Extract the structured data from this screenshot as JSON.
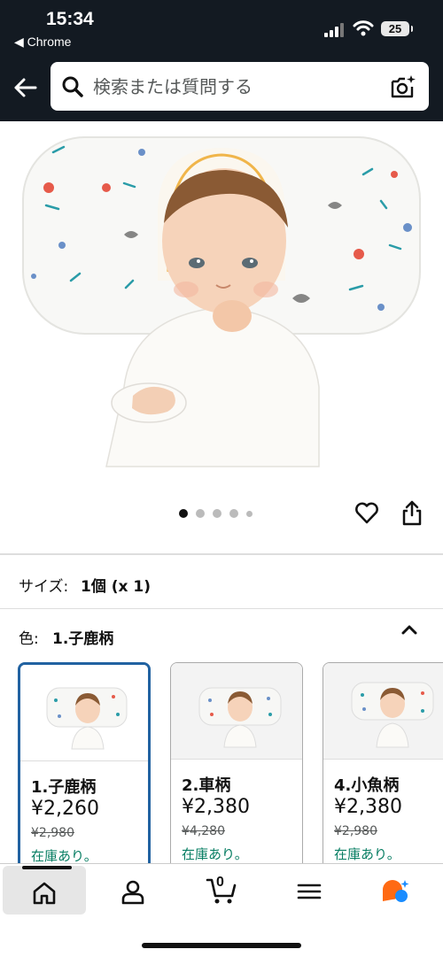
{
  "status_bar": {
    "time": "15:34",
    "back_app": "◀ Chrome",
    "battery": "25"
  },
  "search": {
    "placeholder": "検索または質問する"
  },
  "gallery": {
    "image_count": 5,
    "active_index": 0
  },
  "size": {
    "label": "サイズ:",
    "value": "1個 (x 1)"
  },
  "color": {
    "label": "色:",
    "value": "1.子鹿柄"
  },
  "variants": [
    {
      "name": "1.子鹿柄",
      "price": "¥2,260",
      "old_price": "¥2,980",
      "stock": "在庫あり。",
      "selected": true
    },
    {
      "name": "2.車柄",
      "price": "¥2,380",
      "old_price": "¥4,280",
      "stock": "在庫あり。",
      "selected": false
    },
    {
      "name": "4.小魚柄",
      "price": "¥2,380",
      "old_price": "¥2,980",
      "stock": "在庫あり。",
      "selected": false
    }
  ],
  "tabbar": {
    "cart_count": "0",
    "items": [
      "home-icon",
      "account-icon",
      "cart-icon",
      "menu-icon",
      "assistant-icon"
    ]
  },
  "colors": {
    "header": "#131a22",
    "stock_green": "#067d62",
    "selected_border": "#2162a1",
    "assistant_orange": "#ff6a13",
    "assistant_blue": "#1a8cff"
  }
}
